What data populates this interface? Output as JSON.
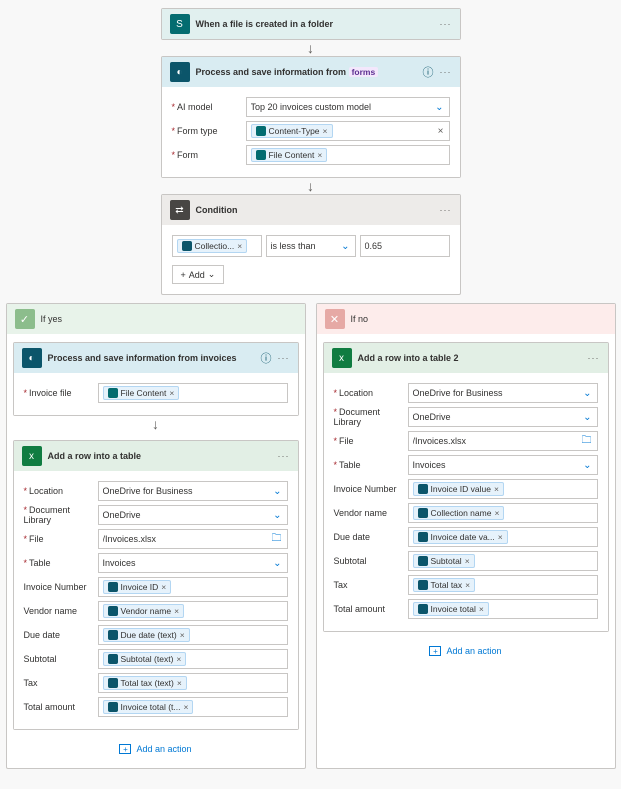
{
  "trigger": {
    "title": "When a file is created in a folder"
  },
  "ai1": {
    "title": "Process and save information from",
    "title_fx": "forms",
    "model_label": "AI model",
    "model_value": "Top 20 invoices custom model",
    "formtype_label": "Form type",
    "formtype_token": "Content-Type",
    "form_label": "Form",
    "form_token": "File Content"
  },
  "condition": {
    "title": "Condition",
    "left_token": "Collectio...",
    "operator": "is less than",
    "value": "0.65",
    "add_label": "Add"
  },
  "yes_label": "If yes",
  "no_label": "If no",
  "ai2": {
    "title": "Process and save information from invoices",
    "file_label": "Invoice file",
    "file_token": "File Content"
  },
  "labels": {
    "location": "Location",
    "doclib": "Document Library",
    "file": "File",
    "table": "Table",
    "invno": "Invoice Number",
    "vendor": "Vendor name",
    "due": "Due date",
    "subtotal": "Subtotal",
    "tax": "Tax",
    "total": "Total amount"
  },
  "xlA": {
    "title": "Add a row into a table",
    "location": "OneDrive for Business",
    "doclib": "OneDrive",
    "file": "/Invoices.xlsx",
    "table": "Invoices",
    "invno": "Invoice ID",
    "vendor": "Vendor name",
    "due": "Due date (text)",
    "subtotal": "Subtotal (text)",
    "tax": "Total tax (text)",
    "total": "Invoice total (t..."
  },
  "xlB": {
    "title": "Add a row into a table 2",
    "location": "OneDrive for Business",
    "doclib": "OneDrive",
    "file": "/Invoices.xlsx",
    "table": "Invoices",
    "invno": "Invoice ID value",
    "vendor": "Collection name",
    "due": "Invoice date va...",
    "subtotal": "Subtotal",
    "tax": "Total tax",
    "total": "Invoice total"
  },
  "add_action": "Add an action"
}
